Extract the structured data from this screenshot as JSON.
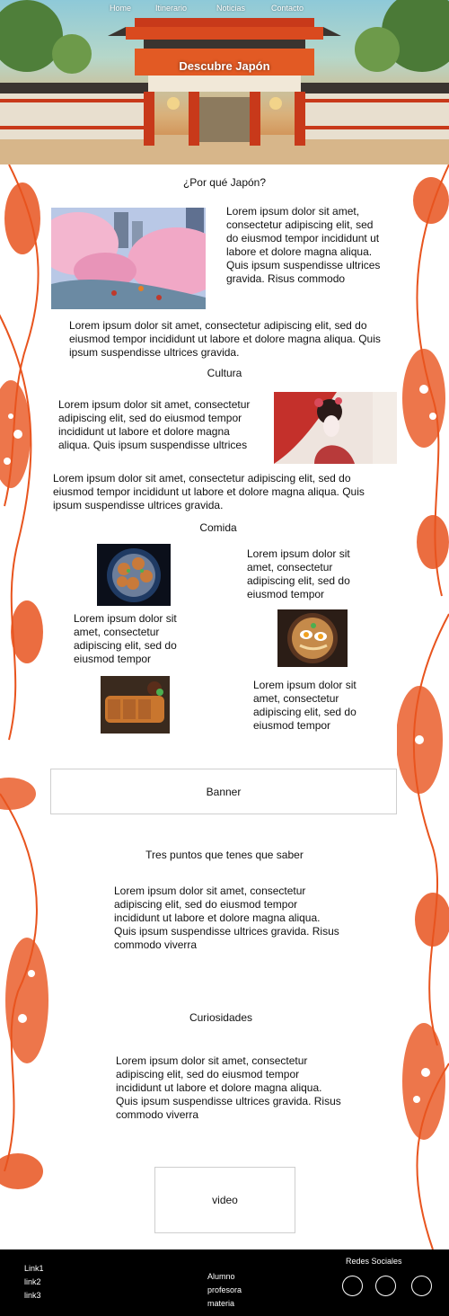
{
  "nav": {
    "items": [
      "Home",
      "Itinerario",
      "Noticias",
      "Contacto"
    ]
  },
  "hero": {
    "title": "Descubre Japón"
  },
  "section_why": {
    "heading": "¿Por qué Japón?",
    "side_text": "Lorem ipsum dolor sit amet, consectetur adipiscing elit, sed do eiusmod tempor incididunt ut labore et dolore magna aliqua. Quis ipsum suspendisse ultrices gravida. Risus commodo",
    "body_text": "Lorem ipsum dolor sit amet, consectetur adipiscing elit, sed do eiusmod tempor incididunt ut labore et dolore magna aliqua. Quis ipsum suspendisse ultrices gravida."
  },
  "section_culture": {
    "heading": "Cultura",
    "side_text": "Lorem ipsum dolor sit amet, consectetur adipiscing elit, sed do eiusmod tempor incididunt ut labore et dolore magna aliqua. Quis ipsum suspendisse ultrices",
    "body_text": "Lorem ipsum dolor sit amet, consectetur adipiscing elit, sed do eiusmod tempor incididunt ut labore et dolore magna aliqua. Quis ipsum suspendisse ultrices gravida."
  },
  "section_food": {
    "heading": "Comida",
    "text_1": "Lorem ipsum dolor sit amet, consectetur adipiscing elit, sed do eiusmod tempor",
    "text_2": "Lorem ipsum dolor sit amet, consectetur adipiscing elit, sed do eiusmod tempor",
    "text_3": "Lorem ipsum dolor sit amet, consectetur adipiscing elit, sed do eiusmod tempor"
  },
  "banner": {
    "label": "Banner"
  },
  "section_tips": {
    "heading": "Tres puntos que tenes que saber",
    "body_text": "Lorem ipsum dolor sit amet, consectetur adipiscing elit, sed do eiusmod tempor incididunt ut labore et dolore magna aliqua. Quis ipsum suspendisse ultrices gravida. Risus commodo viverra"
  },
  "section_curiosities": {
    "heading": "Curiosidades",
    "body_text": "Lorem ipsum dolor sit amet, consectetur adipiscing elit, sed do eiusmod tempor incididunt ut labore et dolore magna aliqua. Quis ipsum suspendisse ultrices gravida. Risus commodo viverra"
  },
  "video": {
    "label": "video"
  },
  "footer": {
    "links": [
      "Link1",
      "link2",
      "link3"
    ],
    "info": [
      "Alumno",
      "profesora",
      "materia"
    ],
    "social_title": "Redes Sociales",
    "social_icons": [
      "social-circle-1",
      "social-circle-2",
      "social-circle-3"
    ]
  },
  "colors": {
    "koi_orange": "#e8541e",
    "footer_bg": "#000000",
    "temple_red": "#c8391a"
  }
}
